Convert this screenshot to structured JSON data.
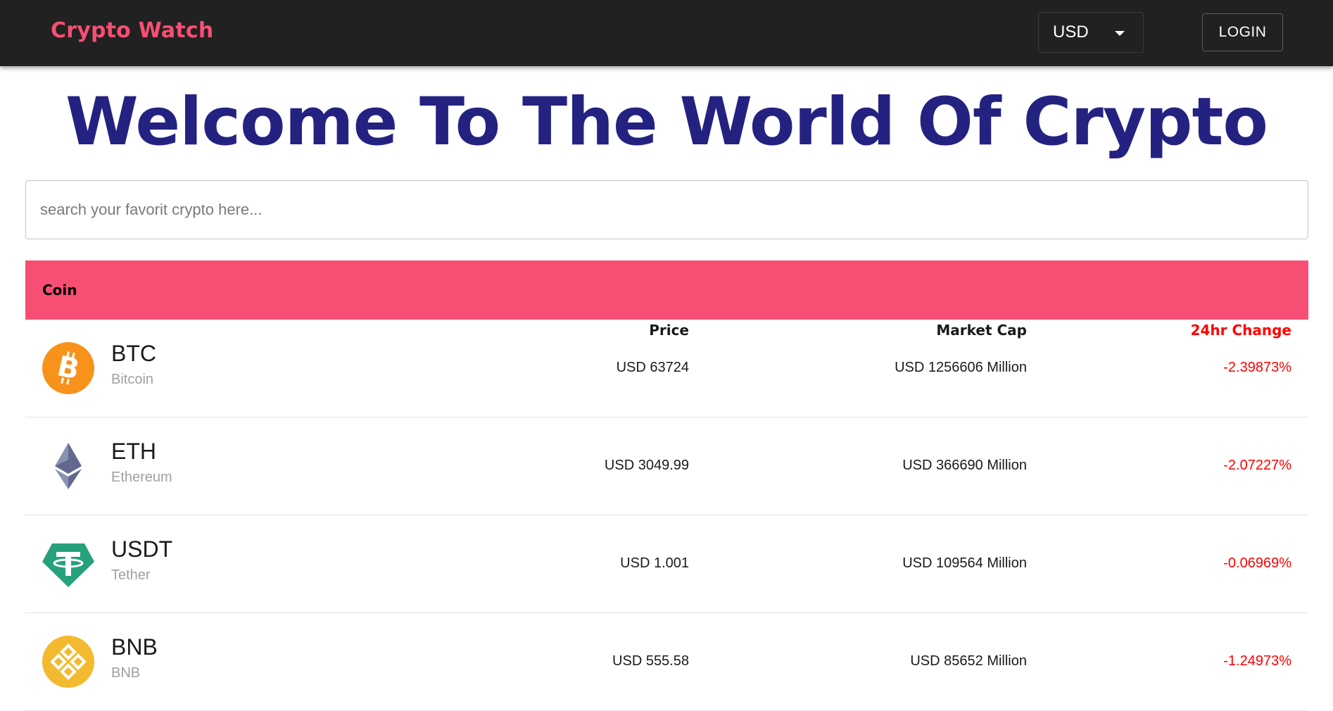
{
  "header": {
    "brand": "Crypto Watch",
    "currency": "USD",
    "login_label": "LOGIN"
  },
  "hero": {
    "title": "Welcome To The World Of Crypto"
  },
  "search": {
    "placeholder": "search your favorit crypto here..."
  },
  "table": {
    "columns": [
      "Coin",
      "Price",
      "Market Cap",
      "24hr Change"
    ],
    "rows": [
      {
        "symbol": "BTC",
        "name": "Bitcoin",
        "price": "USD 63724",
        "market_cap": "USD 1256606 Million",
        "change": "-2.39873%",
        "icon": "bitcoin-icon"
      },
      {
        "symbol": "ETH",
        "name": "Ethereum",
        "price": "USD 3049.99",
        "market_cap": "USD 366690 Million",
        "change": "-2.07227%",
        "icon": "ethereum-icon"
      },
      {
        "symbol": "USDT",
        "name": "Tether",
        "price": "USD 1.001",
        "market_cap": "USD 109564 Million",
        "change": "-0.06969%",
        "icon": "tether-icon"
      },
      {
        "symbol": "BNB",
        "name": "BNB",
        "price": "USD 555.58",
        "market_cap": "USD 85652 Million",
        "change": "-1.24973%",
        "icon": "bnb-icon"
      }
    ]
  },
  "colors": {
    "appbar": "#212121",
    "brand": "#f74f73",
    "hero": "#242281",
    "table_header": "#f74f73",
    "negative": "#ff0000"
  }
}
